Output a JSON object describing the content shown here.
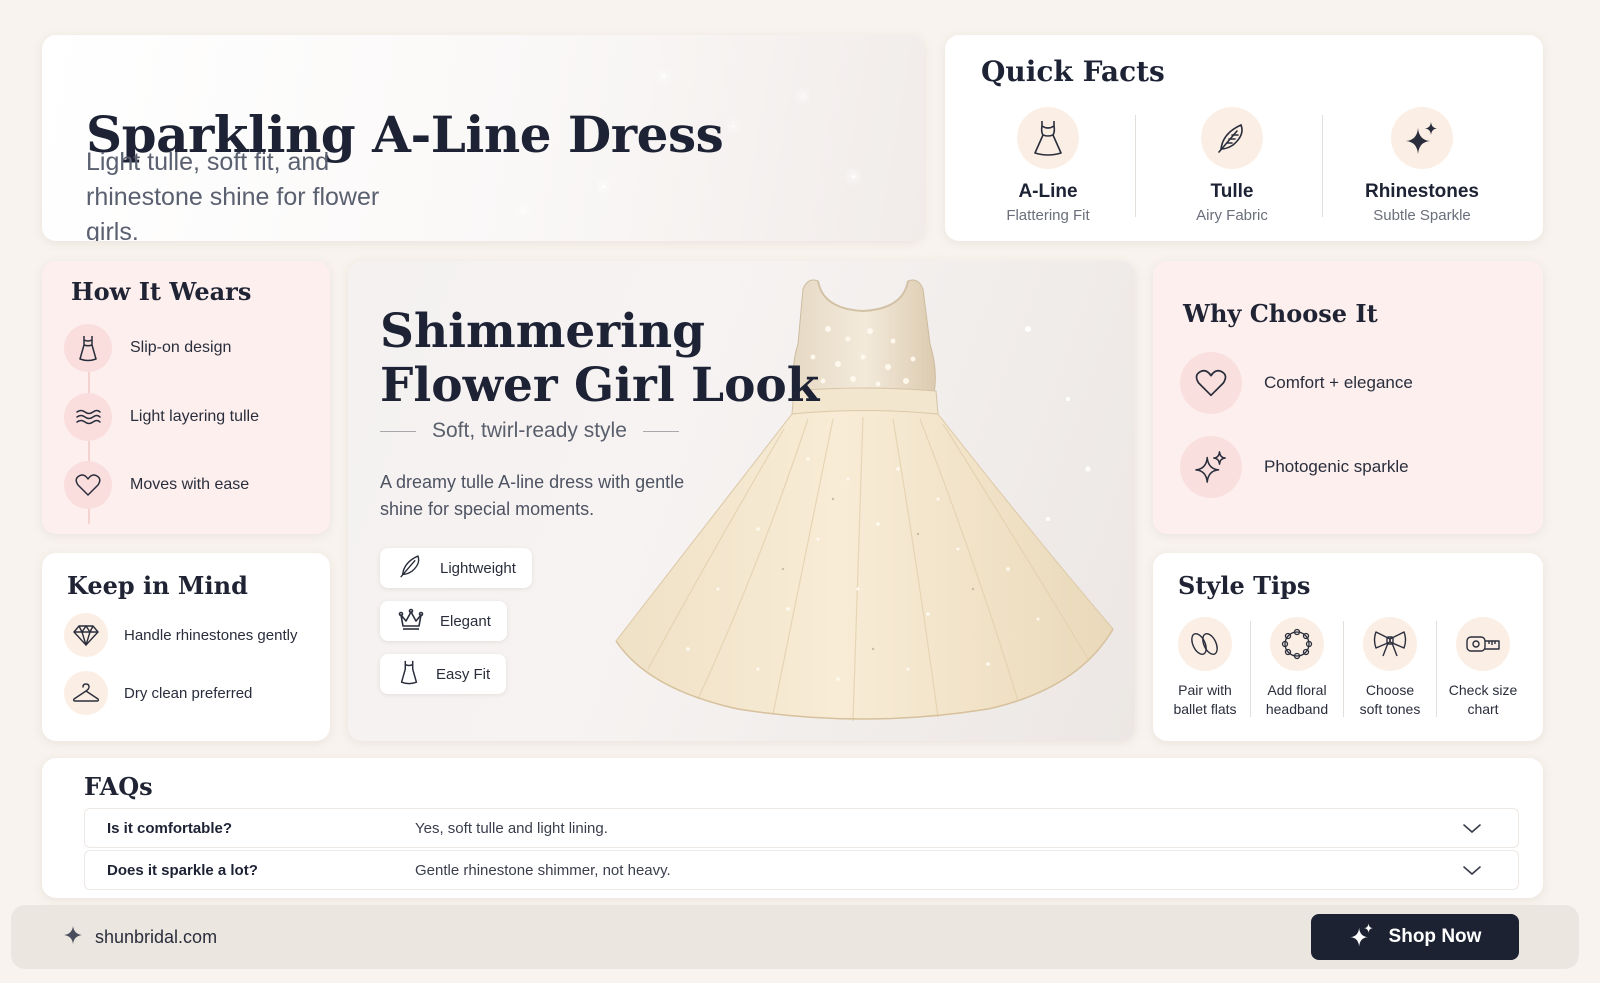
{
  "hero": {
    "title": "Sparkling A-Line Dress",
    "subtitle": "Light tulle, soft fit, and rhinestone shine for flower girls."
  },
  "quick_facts": {
    "heading": "Quick Facts",
    "items": [
      {
        "icon": "dress-icon",
        "name": "A-Line",
        "desc": "Flattering Fit"
      },
      {
        "icon": "feather-icon",
        "name": "Tulle",
        "desc": "Airy Fabric"
      },
      {
        "icon": "sparkle-icon",
        "name": "Rhinestones",
        "desc": "Subtle Sparkle"
      }
    ]
  },
  "how_it_wears": {
    "heading": "How It Wears",
    "items": [
      {
        "icon": "dress-icon",
        "label": "Slip-on design"
      },
      {
        "icon": "waves-icon",
        "label": "Light layering tulle"
      },
      {
        "icon": "heart-icon",
        "label": "Moves with ease"
      }
    ]
  },
  "keep_in_mind": {
    "heading": "Keep in Mind",
    "items": [
      {
        "icon": "diamond-icon",
        "label": "Handle rhinestones gently"
      },
      {
        "icon": "hanger-icon",
        "label": "Dry clean preferred"
      }
    ]
  },
  "feature": {
    "title_line1": "Shimmering",
    "title_line2": "Flower Girl Look",
    "tagline": "Soft, twirl-ready style",
    "description": "A dreamy tulle A-line dress with gentle shine for special moments.",
    "pills": [
      {
        "icon": "feather-icon",
        "label": "Lightweight"
      },
      {
        "icon": "crown-icon",
        "label": "Elegant"
      },
      {
        "icon": "dress-icon",
        "label": "Easy Fit"
      }
    ]
  },
  "why_choose": {
    "heading": "Why Choose It",
    "items": [
      {
        "icon": "heart-icon",
        "label": "Comfort + elegance"
      },
      {
        "icon": "sparkle-icon",
        "label": "Photogenic sparkle"
      }
    ]
  },
  "style_tips": {
    "heading": "Style Tips",
    "items": [
      {
        "icon": "ballet-flats-icon",
        "line1": "Pair with",
        "line2": "ballet flats"
      },
      {
        "icon": "floral-headband-icon",
        "line1": "Add floral",
        "line2": "headband"
      },
      {
        "icon": "bow-icon",
        "line1": "Choose",
        "line2": "soft tones"
      },
      {
        "icon": "measuring-tape-icon",
        "line1": "Check size",
        "line2": "chart"
      }
    ]
  },
  "faqs": {
    "heading": "FAQs",
    "items": [
      {
        "q": "Is it comfortable?",
        "a": "Yes, soft tulle and light lining."
      },
      {
        "q": "Does it sparkle a lot?",
        "a": "Gentle rhinestone shimmer, not heavy."
      }
    ]
  },
  "footer": {
    "site": "shunbridal.com",
    "cta": "Shop Now"
  },
  "colors": {
    "background": "#f8f3ee",
    "ink": "#1d2234",
    "blush": "#fcefee",
    "peach": "#fbeee4",
    "button": "#1c2231"
  }
}
